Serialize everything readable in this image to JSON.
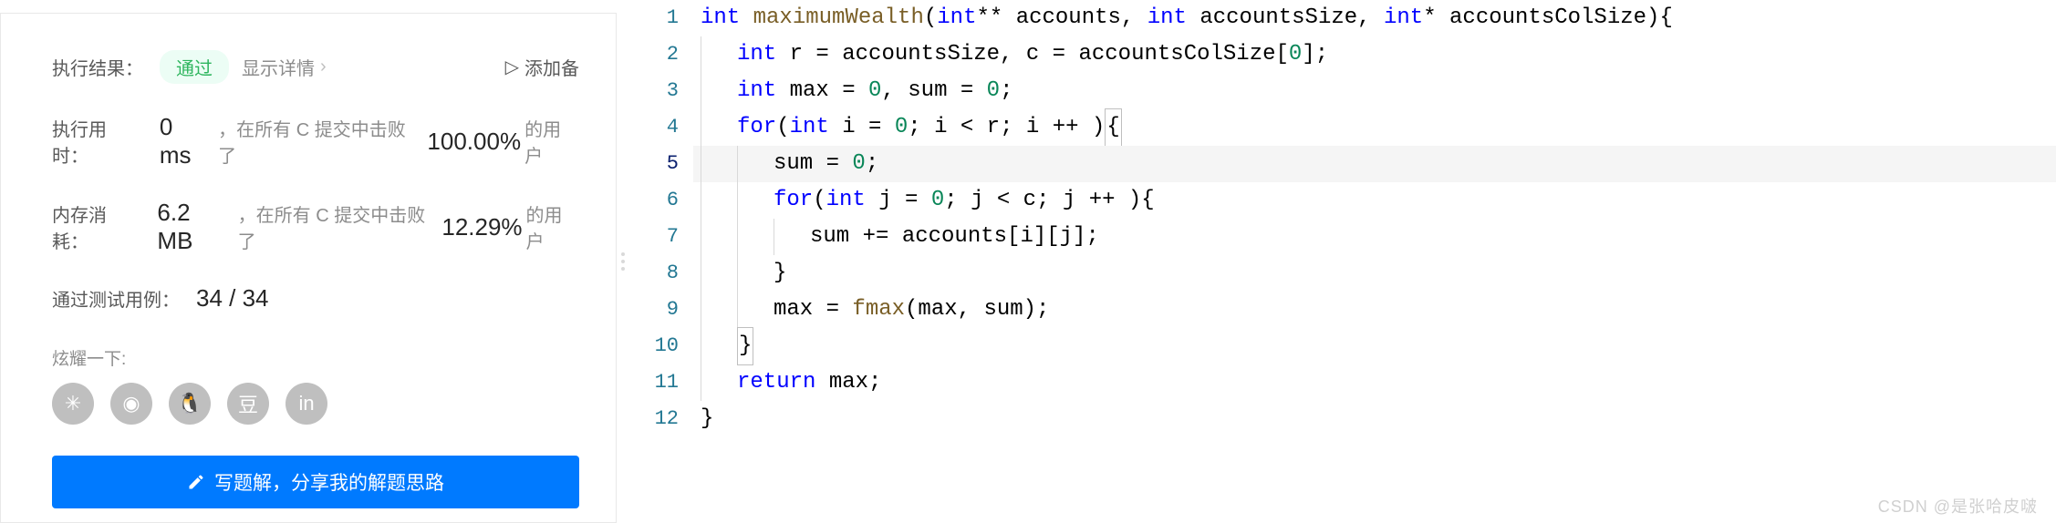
{
  "result": {
    "label": "执行结果：",
    "status": "通过",
    "detail_link": "显示详情",
    "add_note": "添加备"
  },
  "runtime": {
    "label": "执行用时：",
    "value": "0 ms",
    "prefix": "，在所有 C 提交中击败了",
    "percent": "100.00%",
    "suffix": " 的用户"
  },
  "memory": {
    "label": "内存消耗：",
    "value": "6.2 MB",
    "prefix": "，在所有 C 提交中击败了",
    "percent": "12.29%",
    "suffix": " 的用户"
  },
  "testcases": {
    "label": "通过测试用例：",
    "value": "34 / 34"
  },
  "share": {
    "label": "炫耀一下:",
    "icons": [
      "wechat",
      "weibo",
      "qq",
      "douban",
      "linkedin"
    ]
  },
  "button": {
    "label": "写题解，分享我的解题思路"
  },
  "code": {
    "lines": [
      {
        "n": 1,
        "indent": 0,
        "tokens": [
          [
            "kw",
            "int"
          ],
          [
            "plain",
            " "
          ],
          [
            "fn",
            "maximumWealth"
          ],
          [
            "plain",
            "("
          ],
          [
            "kw",
            "int"
          ],
          [
            "plain",
            "** accounts, "
          ],
          [
            "kw",
            "int"
          ],
          [
            "plain",
            " accountsSize, "
          ],
          [
            "kw",
            "int"
          ],
          [
            "plain",
            "* accountsColSize){"
          ]
        ]
      },
      {
        "n": 2,
        "indent": 1,
        "tokens": [
          [
            "kw",
            "int"
          ],
          [
            "plain",
            " r = accountsSize, c = accountsColSize["
          ],
          [
            "num",
            "0"
          ],
          [
            "plain",
            "];"
          ]
        ]
      },
      {
        "n": 3,
        "indent": 1,
        "tokens": [
          [
            "kw",
            "int"
          ],
          [
            "plain",
            " max = "
          ],
          [
            "num",
            "0"
          ],
          [
            "plain",
            ", sum = "
          ],
          [
            "num",
            "0"
          ],
          [
            "plain",
            ";"
          ]
        ]
      },
      {
        "n": 4,
        "indent": 1,
        "tokens": [
          [
            "kw",
            "for"
          ],
          [
            "plain",
            "("
          ],
          [
            "kw",
            "int"
          ],
          [
            "plain",
            " i = "
          ],
          [
            "num",
            "0"
          ],
          [
            "plain",
            "; i < r; i ++ ){"
          ]
        ]
      },
      {
        "n": 5,
        "indent": 2,
        "tokens": [
          [
            "plain",
            "sum = "
          ],
          [
            "num",
            "0"
          ],
          [
            "plain",
            ";"
          ]
        ],
        "active": true
      },
      {
        "n": 6,
        "indent": 2,
        "tokens": [
          [
            "kw",
            "for"
          ],
          [
            "plain",
            "("
          ],
          [
            "kw",
            "int"
          ],
          [
            "plain",
            " j = "
          ],
          [
            "num",
            "0"
          ],
          [
            "plain",
            "; j < c; j ++ ){"
          ]
        ]
      },
      {
        "n": 7,
        "indent": 3,
        "tokens": [
          [
            "plain",
            "sum += accounts[i][j];"
          ]
        ]
      },
      {
        "n": 8,
        "indent": 2,
        "tokens": [
          [
            "plain",
            "}"
          ]
        ]
      },
      {
        "n": 9,
        "indent": 2,
        "tokens": [
          [
            "plain",
            "max = "
          ],
          [
            "fn",
            "fmax"
          ],
          [
            "plain",
            "(max, sum);"
          ]
        ]
      },
      {
        "n": 10,
        "indent": 1,
        "tokens": [
          [
            "plain",
            "}"
          ]
        ],
        "boxed": true
      },
      {
        "n": 11,
        "indent": 1,
        "tokens": [
          [
            "kw",
            "return"
          ],
          [
            "plain",
            " max;"
          ]
        ]
      },
      {
        "n": 12,
        "indent": 0,
        "tokens": [
          [
            "plain",
            "}"
          ]
        ]
      }
    ]
  },
  "watermark": "CSDN @是张哈皮啵"
}
